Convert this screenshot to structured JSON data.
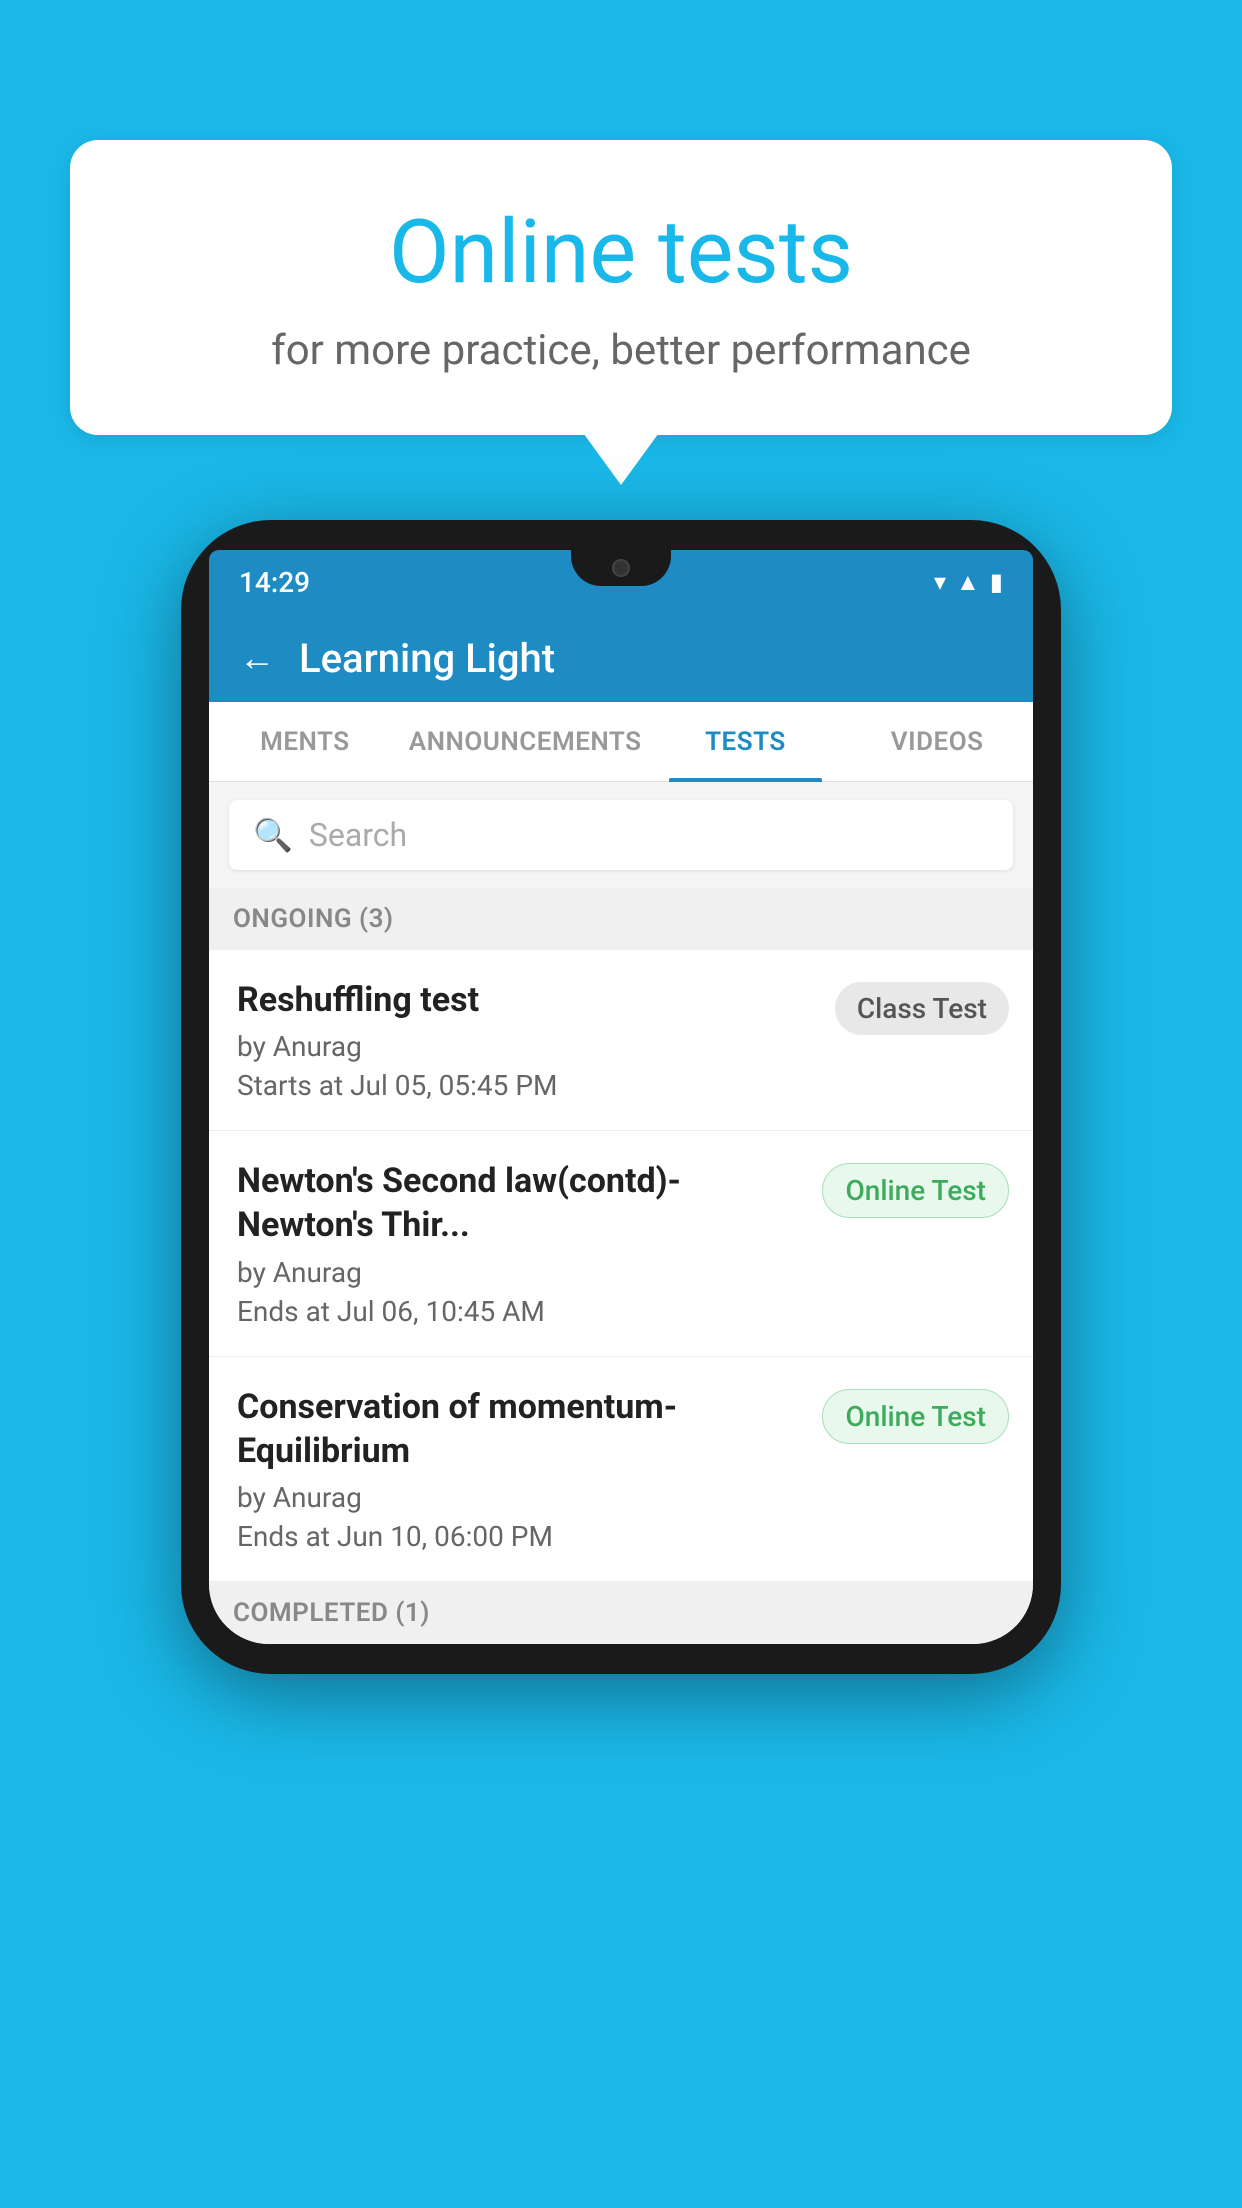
{
  "background": {
    "color": "#1ab8e8"
  },
  "speech_bubble": {
    "title": "Online tests",
    "subtitle": "for more practice, better performance"
  },
  "phone": {
    "status_bar": {
      "time": "14:29",
      "icons": [
        "wifi",
        "signal",
        "battery"
      ]
    },
    "header": {
      "title": "Learning Light",
      "back_label": "←"
    },
    "tabs": [
      {
        "label": "MENTS",
        "active": false
      },
      {
        "label": "ANNOUNCEMENTS",
        "active": false
      },
      {
        "label": "TESTS",
        "active": true
      },
      {
        "label": "VIDEOS",
        "active": false
      }
    ],
    "search": {
      "placeholder": "Search"
    },
    "ongoing_section": {
      "label": "ONGOING (3)"
    },
    "test_items": [
      {
        "title": "Reshuffling test",
        "author": "by Anurag",
        "date": "Starts at  Jul 05, 05:45 PM",
        "badge": "Class Test",
        "badge_type": "class"
      },
      {
        "title": "Newton's Second law(contd)-Newton's Thir...",
        "author": "by Anurag",
        "date": "Ends at  Jul 06, 10:45 AM",
        "badge": "Online Test",
        "badge_type": "online"
      },
      {
        "title": "Conservation of momentum-Equilibrium",
        "author": "by Anurag",
        "date": "Ends at  Jun 10, 06:00 PM",
        "badge": "Online Test",
        "badge_type": "online"
      }
    ],
    "completed_section": {
      "label": "COMPLETED (1)"
    }
  }
}
